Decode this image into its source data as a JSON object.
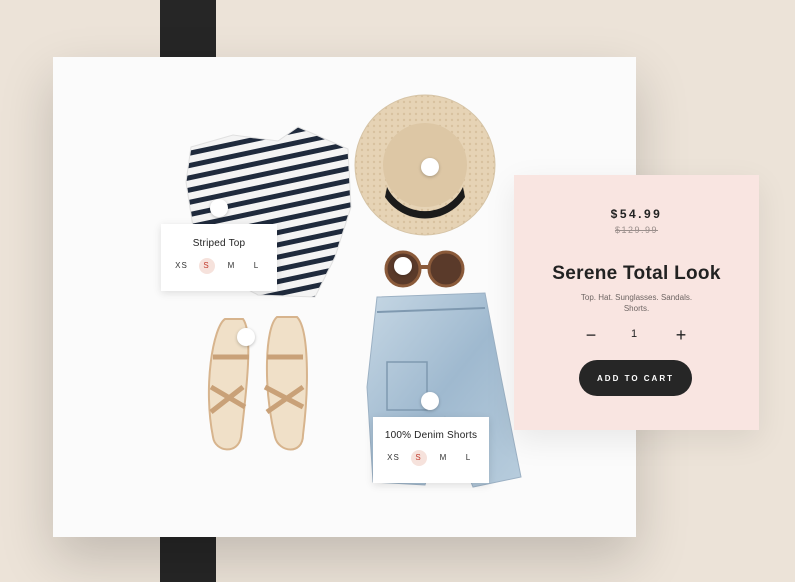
{
  "hotspots": [
    {
      "label": "Striped Top",
      "sizes": [
        "XS",
        "S",
        "M",
        "L"
      ],
      "selected": "S"
    },
    {
      "label": "100% Denim Shorts",
      "sizes": [
        "XS",
        "S",
        "M",
        "L"
      ],
      "selected": "S"
    }
  ],
  "product": {
    "price": "$54.99",
    "old_price": "$129.99",
    "title": "Serene Total Look",
    "description": "Top. Hat. Sunglasses. Sandals. Shorts.",
    "quantity": "1",
    "minus_icon": "minus-icon",
    "plus_icon": "plus-icon",
    "cta_label": "ADD TO CART"
  },
  "colors": {
    "background": "#ece3d8",
    "card": "#f9e5e1",
    "dark": "#262626",
    "selected_size": "#c0392b"
  }
}
